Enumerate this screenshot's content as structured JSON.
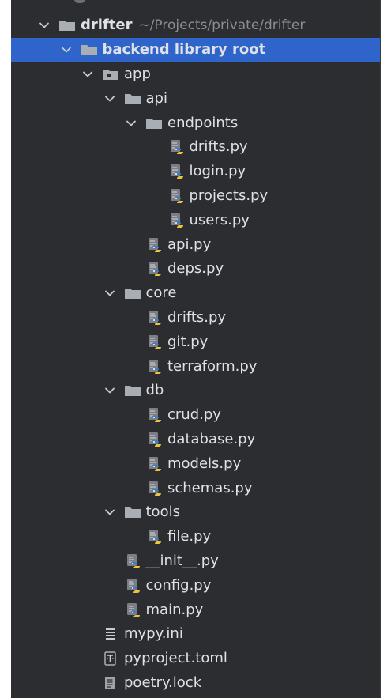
{
  "project_tree": {
    "root": {
      "name": "drifter",
      "path": "~/Projects/private/drifter"
    },
    "items": [
      {
        "label": "backend library root",
        "depth": 1,
        "type": "folder",
        "expanded": true,
        "selected": true,
        "bold": true
      },
      {
        "label": "app",
        "depth": 2,
        "type": "module-folder",
        "expanded": true
      },
      {
        "label": "api",
        "depth": 3,
        "type": "folder",
        "expanded": true
      },
      {
        "label": "endpoints",
        "depth": 4,
        "type": "folder",
        "expanded": true
      },
      {
        "label": "drifts.py",
        "depth": 5,
        "type": "python"
      },
      {
        "label": "login.py",
        "depth": 5,
        "type": "python"
      },
      {
        "label": "projects.py",
        "depth": 5,
        "type": "python"
      },
      {
        "label": "users.py",
        "depth": 5,
        "type": "python"
      },
      {
        "label": "api.py",
        "depth": 4,
        "type": "python"
      },
      {
        "label": "deps.py",
        "depth": 4,
        "type": "python"
      },
      {
        "label": "core",
        "depth": 3,
        "type": "folder",
        "expanded": true
      },
      {
        "label": "drifts.py",
        "depth": 4,
        "type": "python"
      },
      {
        "label": "git.py",
        "depth": 4,
        "type": "python"
      },
      {
        "label": "terraform.py",
        "depth": 4,
        "type": "python"
      },
      {
        "label": "db",
        "depth": 3,
        "type": "folder",
        "expanded": true
      },
      {
        "label": "crud.py",
        "depth": 4,
        "type": "python"
      },
      {
        "label": "database.py",
        "depth": 4,
        "type": "python"
      },
      {
        "label": "models.py",
        "depth": 4,
        "type": "python"
      },
      {
        "label": "schemas.py",
        "depth": 4,
        "type": "python"
      },
      {
        "label": "tools",
        "depth": 3,
        "type": "folder",
        "expanded": true
      },
      {
        "label": "file.py",
        "depth": 4,
        "type": "python"
      },
      {
        "label": "__init__.py",
        "depth": 3,
        "type": "python"
      },
      {
        "label": "config.py",
        "depth": 3,
        "type": "python"
      },
      {
        "label": "main.py",
        "depth": 3,
        "type": "python"
      },
      {
        "label": "mypy.ini",
        "depth": 2,
        "type": "ini"
      },
      {
        "label": "pyproject.toml",
        "depth": 2,
        "type": "toml"
      },
      {
        "label": "poetry.lock",
        "depth": 2,
        "type": "lock"
      }
    ]
  },
  "colors": {
    "panel_bg": "#2b2d30",
    "selection": "#2f65ca",
    "text": "#dfe1e5",
    "path_text": "#8a8d93",
    "folder": "#a9adb4",
    "python_blue": "#3e7fc3",
    "python_yellow": "#f2c43d"
  }
}
